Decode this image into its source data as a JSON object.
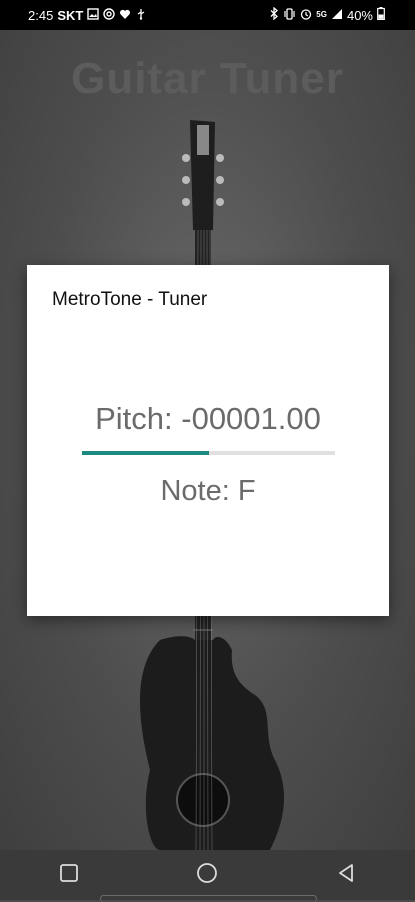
{
  "status_bar": {
    "time": "2:45",
    "carrier": "SKT",
    "battery": "40%",
    "left_icons": [
      "image-icon",
      "at-sign-icon",
      "heart-icon",
      "usb-icon"
    ],
    "right_icons": [
      "bluetooth-icon",
      "vibrate-icon",
      "alarm-icon",
      "mobile-data-icon",
      "signal-icon",
      "battery-icon"
    ]
  },
  "app": {
    "title": "Guitar Tuner"
  },
  "dialog": {
    "title": "MetroTone - Tuner",
    "pitch": "Pitch: -00001.00",
    "note": "Note: F",
    "progress_fraction": 0.5,
    "progress_color": "#1a8b7e"
  },
  "nav_bar": {
    "buttons": [
      "recent-apps-icon",
      "home-icon",
      "back-icon"
    ]
  }
}
